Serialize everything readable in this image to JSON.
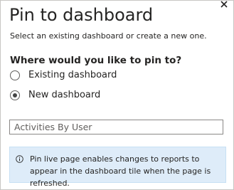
{
  "dialog": {
    "title": "Pin to dashboard",
    "subtitle": "Select an existing dashboard or create a new one.",
    "close_icon": "close-icon"
  },
  "question": {
    "label": "Where would you like to pin to?",
    "options": [
      {
        "label": "Existing dashboard",
        "selected": false
      },
      {
        "label": "New dashboard",
        "selected": true
      }
    ]
  },
  "dashboard_name": {
    "value": "Activities By User"
  },
  "info": {
    "icon": "info-icon",
    "text": "Pin live page enables changes to reports to appear in the dashboard tile when the page is refreshed."
  }
}
